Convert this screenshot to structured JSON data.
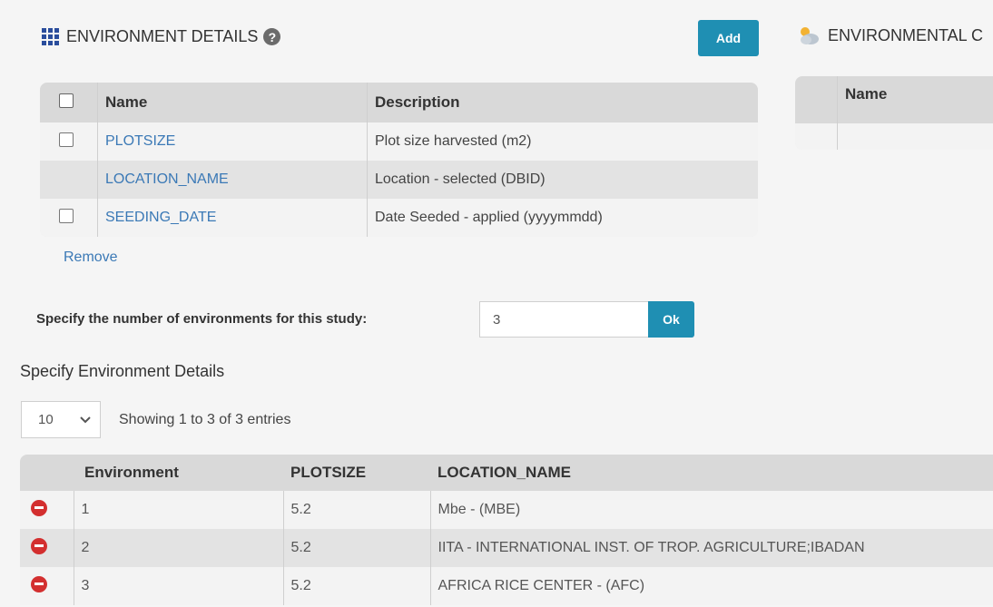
{
  "env_details": {
    "title": "ENVIRONMENT DETAILS",
    "add_label": "Add",
    "columns": {
      "name": "Name",
      "description": "Description"
    },
    "rows": [
      {
        "name": "PLOTSIZE",
        "description": "Plot size harvested (m2)"
      },
      {
        "name": "LOCATION_NAME",
        "description": "Location - selected (DBID)"
      },
      {
        "name": "SEEDING_DATE",
        "description": "Date Seeded - applied (yyyymmdd)"
      }
    ],
    "remove_label": "Remove"
  },
  "env_conditions": {
    "title": "ENVIRONMENTAL C",
    "columns": {
      "name": "Name"
    }
  },
  "num_envs": {
    "label": "Specify the number of environments for this study:",
    "value": "3",
    "ok_label": "Ok"
  },
  "specify": {
    "title": "Specify Environment Details",
    "page_size": "10",
    "showing": "Showing 1 to 3 of 3 entries",
    "columns": {
      "environment": "Environment",
      "plotsize": "PLOTSIZE",
      "location": "LOCATION_NAME"
    },
    "rows": [
      {
        "env": "1",
        "plotsize": "5.2",
        "location": "Mbe - (MBE)"
      },
      {
        "env": "2",
        "plotsize": "5.2",
        "location": "IITA - INTERNATIONAL INST. OF TROP. AGRICULTURE;IBADAN"
      },
      {
        "env": "3",
        "plotsize": "5.2",
        "location": "AFRICA RICE CENTER - (AFC)"
      }
    ]
  },
  "colors": {
    "accent": "#1f8fb3",
    "link": "#3b79b6",
    "danger": "#d32f2f",
    "icon": "#2a4d9c"
  }
}
